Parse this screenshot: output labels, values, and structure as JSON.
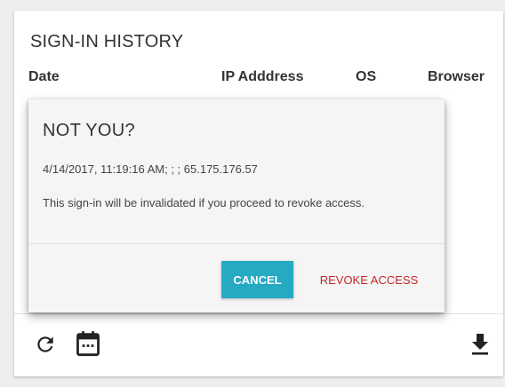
{
  "card": {
    "title": "SIGN-IN HISTORY",
    "columns": [
      "Date",
      "IP Adddress",
      "OS",
      "Browser"
    ]
  },
  "dialog": {
    "title": "NOT YOU?",
    "details": "4/14/2017, 11:19:16 AM; ; ; 65.175.176.57",
    "message": "This sign-in will be invalidated if you proceed to revoke access.",
    "cancel_label": "CANCEL",
    "revoke_label": "REVOKE ACCESS"
  },
  "toolbar": {
    "icons": [
      "refresh-icon",
      "calendar-icon",
      "download-icon"
    ]
  },
  "colors": {
    "accent": "#26a9c2",
    "danger": "#c62828",
    "background": "#eeeeee"
  }
}
